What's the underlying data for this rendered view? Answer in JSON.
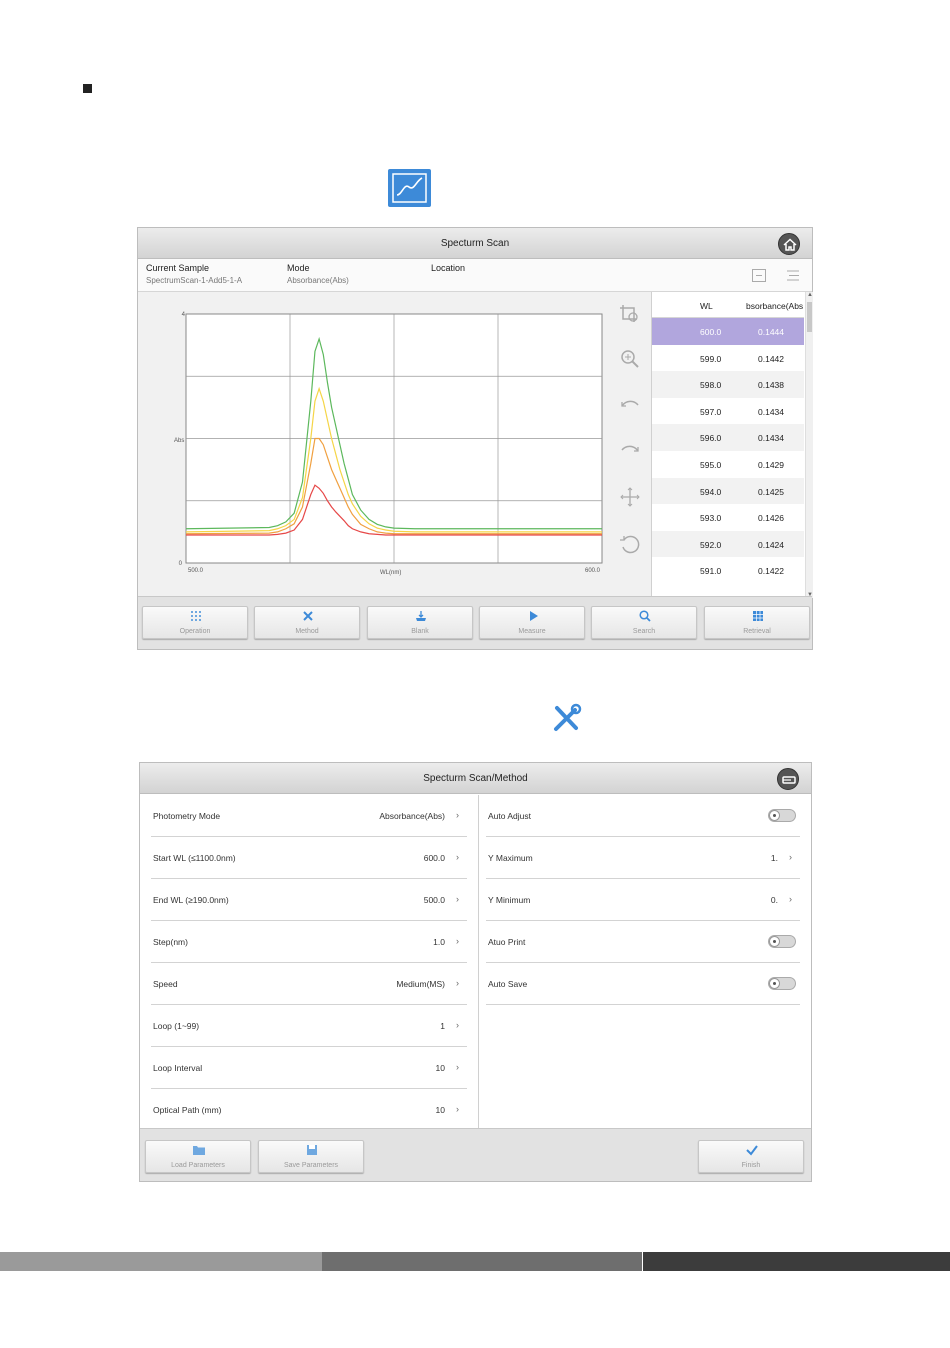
{
  "spectrum_window": {
    "title": "Specturm Scan",
    "current_sample_label": "Current Sample",
    "current_sample_value": "SpectrumScan-1-Add5-1-A",
    "mode_label": "Mode",
    "mode_value": "Absorbance(Abs)",
    "location_label": "Location",
    "table": {
      "col_wl": "WL",
      "col_abs": "bsorbance(Abs",
      "rows": [
        {
          "wl": "600.0",
          "abs": "0.1444"
        },
        {
          "wl": "599.0",
          "abs": "0.1442"
        },
        {
          "wl": "598.0",
          "abs": "0.1438"
        },
        {
          "wl": "597.0",
          "abs": "0.1434"
        },
        {
          "wl": "596.0",
          "abs": "0.1434"
        },
        {
          "wl": "595.0",
          "abs": "0.1429"
        },
        {
          "wl": "594.0",
          "abs": "0.1425"
        },
        {
          "wl": "593.0",
          "abs": "0.1426"
        },
        {
          "wl": "592.0",
          "abs": "0.1424"
        },
        {
          "wl": "591.0",
          "abs": "0.1422"
        }
      ]
    },
    "toolbar": {
      "operation": "Operation",
      "method": "Method",
      "blank": "Blank",
      "measure": "Measure",
      "search": "Search",
      "retrieval": "Retrieval"
    }
  },
  "chart_data": {
    "type": "line",
    "xlabel": "WL(nm)",
    "ylabel": "Abs",
    "xlim": [
      500.0,
      600.0
    ],
    "ylim": [
      0,
      4
    ],
    "x_tick_labels": [
      "500.0",
      "600.0"
    ],
    "y_tick_labels": [
      "0",
      "4"
    ],
    "grid": true,
    "x": [
      500,
      520,
      522,
      524,
      526,
      528,
      530,
      531,
      532,
      533,
      534,
      535,
      536,
      537,
      538,
      539,
      540,
      542,
      544,
      546,
      548,
      550,
      555,
      560,
      580,
      600
    ],
    "series": [
      {
        "color": "#5cb85c",
        "values": [
          0.55,
          0.57,
          0.6,
          0.66,
          0.8,
          1.3,
          2.6,
          3.4,
          3.6,
          3.35,
          2.9,
          2.5,
          2.2,
          1.9,
          1.6,
          1.35,
          1.1,
          0.85,
          0.7,
          0.62,
          0.58,
          0.56,
          0.55,
          0.55,
          0.55,
          0.55
        ]
      },
      {
        "color": "#f5d547",
        "values": [
          0.5,
          0.52,
          0.55,
          0.6,
          0.7,
          1.05,
          2.0,
          2.6,
          2.8,
          2.6,
          2.3,
          2.0,
          1.75,
          1.5,
          1.3,
          1.1,
          0.95,
          0.75,
          0.63,
          0.56,
          0.53,
          0.51,
          0.5,
          0.5,
          0.5,
          0.5
        ]
      },
      {
        "color": "#f0a040",
        "values": [
          0.47,
          0.48,
          0.5,
          0.55,
          0.63,
          0.9,
          1.6,
          2.0,
          2.0,
          1.9,
          1.7,
          1.5,
          1.35,
          1.2,
          1.05,
          0.9,
          0.78,
          0.62,
          0.55,
          0.5,
          0.48,
          0.47,
          0.47,
          0.47,
          0.47,
          0.47
        ]
      },
      {
        "color": "#e64848",
        "values": [
          0.45,
          0.45,
          0.46,
          0.48,
          0.53,
          0.7,
          1.1,
          1.25,
          1.2,
          1.12,
          1.0,
          0.9,
          0.82,
          0.75,
          0.68,
          0.6,
          0.55,
          0.5,
          0.47,
          0.46,
          0.45,
          0.45,
          0.45,
          0.45,
          0.45,
          0.45
        ]
      }
    ]
  },
  "method_window": {
    "title": "Specturm Scan/Method",
    "left_rows": [
      {
        "label": "Photometry Mode",
        "value": "Absorbance(Abs)"
      },
      {
        "label": "Start WL  (≤1100.0nm)",
        "value": "600.0"
      },
      {
        "label": "End WL  (≥190.0nm)",
        "value": "500.0"
      },
      {
        "label": "Step(nm)",
        "value": "1.0"
      },
      {
        "label": "Speed",
        "value": "Medium(MS)"
      },
      {
        "label": "Loop  (1~99)",
        "value": "1"
      },
      {
        "label": "Loop Interval",
        "value": "10"
      },
      {
        "label": "Optical Path  (mm)",
        "value": "10"
      }
    ],
    "right_rows": [
      {
        "label": "Auto Adjust"
      },
      {
        "label": "Y Maximum",
        "value": "1."
      },
      {
        "label": "Y Minimum",
        "value": "0."
      },
      {
        "label": "Atuo Print"
      },
      {
        "label": "Auto Save"
      }
    ],
    "footer": {
      "load": "Load Parameters",
      "save": "Save Parameters",
      "finish": "Finish"
    }
  },
  "colors": {
    "accent_blue": "#3d8ad8",
    "selected_row": "#b1a6dd"
  }
}
